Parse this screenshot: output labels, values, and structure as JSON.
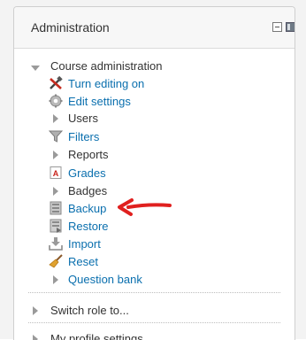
{
  "block": {
    "title": "Administration"
  },
  "course_admin": {
    "label": "Course administration",
    "items": [
      {
        "label": "Turn editing on",
        "icon": "edit-tools-icon",
        "link": true
      },
      {
        "label": "Edit settings",
        "icon": "settings-gear-icon",
        "link": true
      },
      {
        "label": "Users",
        "icon": "expand-triangle-icon",
        "link": false
      },
      {
        "label": "Filters",
        "icon": "filter-funnel-icon",
        "link": true
      },
      {
        "label": "Reports",
        "icon": "expand-triangle-icon",
        "link": false
      },
      {
        "label": "Grades",
        "icon": "grades-icon",
        "link": true
      },
      {
        "label": "Badges",
        "icon": "expand-triangle-icon",
        "link": false
      },
      {
        "label": "Backup",
        "icon": "backup-icon",
        "link": true
      },
      {
        "label": "Restore",
        "icon": "restore-icon",
        "link": true
      },
      {
        "label": "Import",
        "icon": "import-icon",
        "link": true
      },
      {
        "label": "Reset",
        "icon": "reset-broom-icon",
        "link": true
      },
      {
        "label": "Question bank",
        "icon": "expand-triangle-icon",
        "link": true
      }
    ]
  },
  "switch_role": {
    "label": "Switch role to..."
  },
  "profile_settings": {
    "label": "My profile settings"
  },
  "colors": {
    "link": "#0a6fae",
    "text": "#333333",
    "annotation_arrow": "#e0201f"
  }
}
